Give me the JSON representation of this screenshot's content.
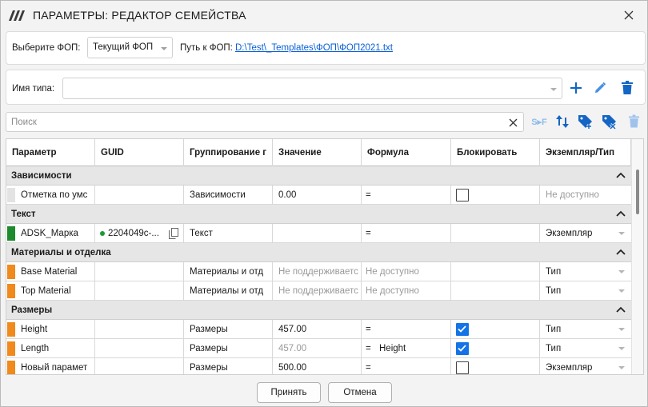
{
  "window": {
    "title": "ПАРАМЕТРЫ: РЕДАКТОР СЕМЕЙСТВА"
  },
  "fop": {
    "label": "Выберите ФОП:",
    "selected": "Текущий ФОП",
    "path_label": "Путь к ФОП:",
    "path_value": "D:\\Test\\_Templates\\ФОП\\ФОП2021.txt"
  },
  "type": {
    "label": "Имя типа:",
    "value": ""
  },
  "search": {
    "placeholder": "Поиск",
    "value": ""
  },
  "toolbar": {
    "sf_label": "S▸F"
  },
  "columns": [
    "Параметр",
    "GUID",
    "Группирование г",
    "Значение",
    "Формула",
    "Блокировать",
    "Экземпляр/Тип"
  ],
  "groups": [
    {
      "name": "Зависимости",
      "rows": [
        {
          "marker": "#e3e3e3",
          "name": "Отметка по умс",
          "guid": "",
          "group": "Зависимости",
          "value": "0.00",
          "value_muted": false,
          "formula": "=",
          "formula_text": "",
          "formula_muted": false,
          "locked": false,
          "lock_shown": true,
          "inst": "Не доступно",
          "inst_muted": true,
          "inst_arrow": false
        }
      ]
    },
    {
      "name": "Текст",
      "rows": [
        {
          "marker": "#1e8a2e",
          "name": "ADSK_Марка",
          "guid": "2204049c-...",
          "group": "Текст",
          "value": "",
          "value_muted": false,
          "formula": "=",
          "formula_text": "",
          "formula_muted": false,
          "locked": false,
          "lock_shown": false,
          "inst": "Экземпляр",
          "inst_muted": false,
          "inst_arrow": true
        }
      ]
    },
    {
      "name": "Материалы и отделка",
      "rows": [
        {
          "marker": "#f08a1c",
          "name": "Base Material",
          "guid": "",
          "group": "Материалы и отд",
          "value": "Не поддерживаетс",
          "value_muted": true,
          "formula": "Не доступно",
          "formula_text": "",
          "formula_muted": true,
          "locked": false,
          "lock_shown": false,
          "inst": "Тип",
          "inst_muted": false,
          "inst_arrow": true
        },
        {
          "marker": "#f08a1c",
          "name": "Top Material",
          "guid": "",
          "group": "Материалы и отд",
          "value": "Не поддерживаетс",
          "value_muted": true,
          "formula": "Не доступно",
          "formula_text": "",
          "formula_muted": true,
          "locked": false,
          "lock_shown": false,
          "inst": "Тип",
          "inst_muted": false,
          "inst_arrow": true
        }
      ]
    },
    {
      "name": "Размеры",
      "rows": [
        {
          "marker": "#f08a1c",
          "name": "Height",
          "guid": "",
          "group": "Размеры",
          "value": "457.00",
          "value_muted": false,
          "formula": "=",
          "formula_text": "",
          "formula_muted": false,
          "locked": true,
          "lock_shown": true,
          "inst": "Тип",
          "inst_muted": false,
          "inst_arrow": true
        },
        {
          "marker": "#f08a1c",
          "name": "Length",
          "guid": "",
          "group": "Размеры",
          "value": "457.00",
          "value_muted": true,
          "formula": "=",
          "formula_text": "Height",
          "formula_muted": false,
          "locked": true,
          "lock_shown": true,
          "inst": "Тип",
          "inst_muted": false,
          "inst_arrow": true
        },
        {
          "marker": "#f08a1c",
          "name": "Новый парамет",
          "guid": "",
          "group": "Размеры",
          "value": "500.00",
          "value_muted": false,
          "formula": "=",
          "formula_text": "",
          "formula_muted": false,
          "locked": false,
          "lock_shown": true,
          "inst": "Экземпляр",
          "inst_muted": false,
          "inst_arrow": true
        }
      ]
    }
  ],
  "buttons": {
    "ok": "Принять",
    "cancel": "Отмена"
  },
  "colors": {
    "accent": "#1473e6",
    "icon_blue": "#1466c4",
    "disabled_icon": "#9ec2ec"
  }
}
